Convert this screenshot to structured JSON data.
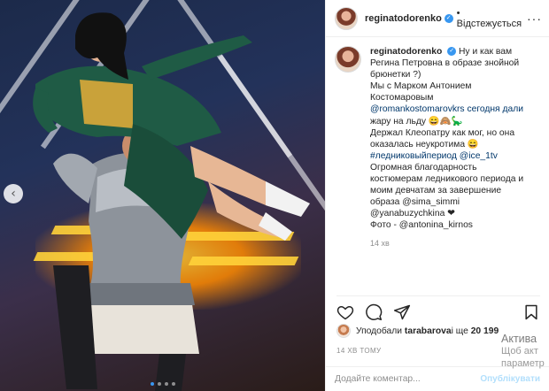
{
  "header": {
    "username": "reginatodorenko",
    "follow_state": "Відстежується",
    "more_icon": "ellipsis-icon"
  },
  "caption": {
    "username": "reginatodorenko",
    "lines": [
      "Ну и как вам",
      "Регина Петровна в образе знойной",
      "брюнетки ?)",
      "Мы с Марком Антонием",
      "Костомаровым",
      "@romankostomarovkrs сегодня дали",
      "жару на льду 😄🙈🦕",
      "Держал Клеопатру как мог, но она",
      "оказалась неукротима 😄",
      "#ледниковыйпериод @ice_1tv",
      "Огромная благодарность",
      "костюмерам ледникового периода и",
      "моим девчатам за завершение",
      "образа @sima_simmi",
      "@yanabuzychkina ❤",
      "Фото - @antonina_kirnos"
    ],
    "time": "14 хв"
  },
  "likes": {
    "prefix": "Уподобали ",
    "user": "tarabarova",
    "middle": " і ще ",
    "count": "20 199"
  },
  "posted_ago": "14 ХВ ТОМУ",
  "comment": {
    "placeholder": "Додайте коментар...",
    "publish_label": "Опублікувати"
  },
  "windows_watermark": {
    "title": "Актива",
    "line1": "Щоб акт",
    "line2": "параметр"
  },
  "icons": [
    "heart-icon",
    "comment-icon",
    "share-icon",
    "bookmark-icon",
    "emoji-icon",
    "chevron-left-icon"
  ],
  "colors": {
    "link": "#00376b",
    "verified": "#3897f0",
    "muted": "#8e8e8e",
    "publish": "#b2dffc"
  }
}
